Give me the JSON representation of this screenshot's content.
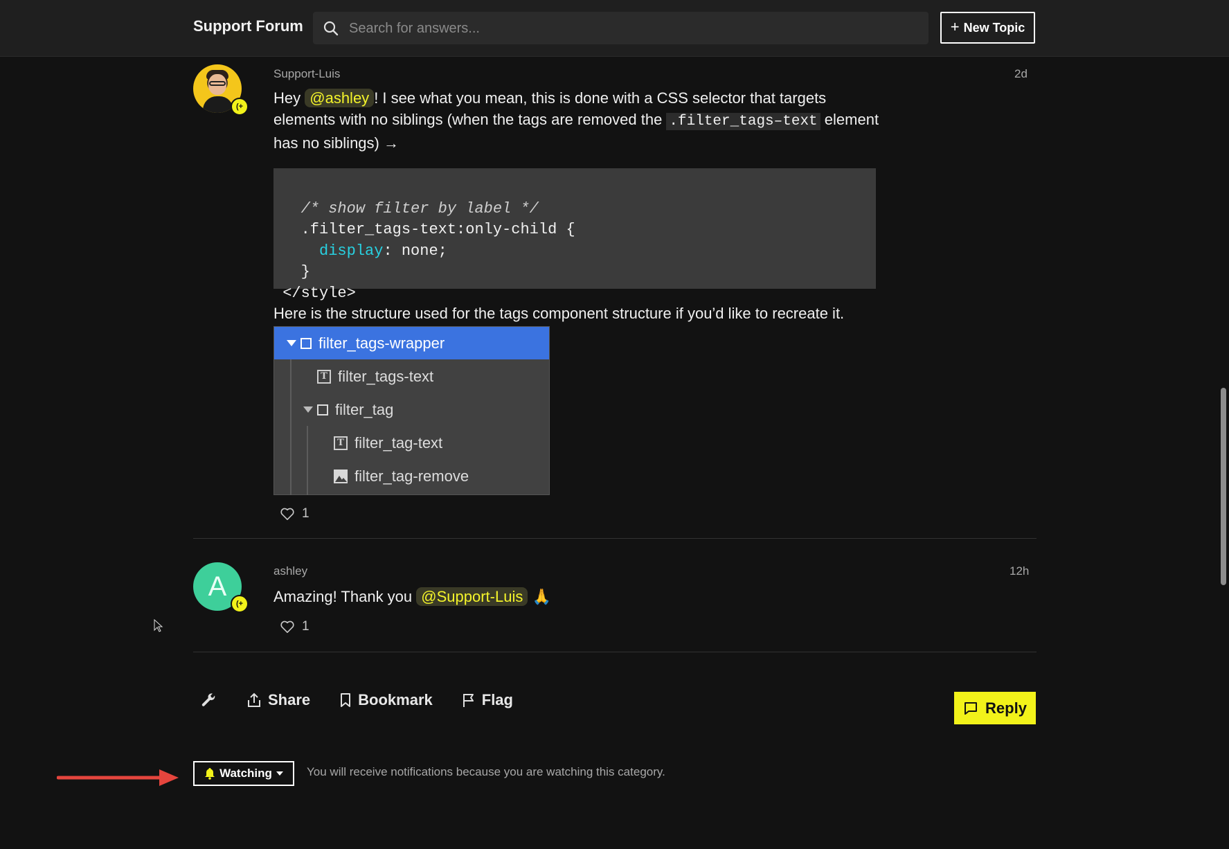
{
  "header": {
    "brand": "Support Forum",
    "search_placeholder": "Search for answers...",
    "new_topic_label": "New Topic"
  },
  "posts": [
    {
      "username": "Support-Luis",
      "time": "2d",
      "text_before_mention": "Hey ",
      "mention": "@ashley",
      "text_after_mention": "! I see what you mean, this is done with a CSS selector that targets elements with no siblings (when the tags are removed the ",
      "inline_code": ".filter_tags–text",
      "text_after_code": " element has no siblings) →",
      "code_lines": [
        {
          "indent": "   ",
          "text": "/* show filter by label */",
          "kind": "comment"
        },
        {
          "indent": "   ",
          "text": ".filter_tags-text:only-child {",
          "kind": "plain"
        },
        {
          "indent": "     ",
          "prop": "display",
          "rest": ": none;",
          "kind": "decl"
        },
        {
          "indent": "   ",
          "text": "}",
          "kind": "plain"
        },
        {
          "indent": " ",
          "text": "</style>",
          "kind": "plain"
        }
      ],
      "structure_text": "Here is the structure used for the tags component structure if you’d like to recreate it.",
      "tree": [
        {
          "label": "filter_tags-wrapper",
          "icon": "box-icon",
          "caret": true,
          "selected": true
        },
        {
          "label": "filter_tags-text",
          "icon": "text-icon",
          "caret": false,
          "selected": false
        },
        {
          "label": "filter_tag",
          "icon": "box-icon",
          "caret": true,
          "selected": false
        },
        {
          "label": "filter_tag-text",
          "icon": "text-icon",
          "caret": false,
          "selected": false
        },
        {
          "label": "filter_tag-remove",
          "icon": "image-icon",
          "caret": false,
          "selected": false
        }
      ],
      "likes": "1"
    },
    {
      "username": "ashley",
      "avatar_letter": "A",
      "time": "12h",
      "text_before_mention": "Amazing! Thank you ",
      "mention": "@Support-Luis",
      "emoji": "🙏",
      "likes": "1"
    }
  ],
  "actions": {
    "share": "Share",
    "bookmark": "Bookmark",
    "flag": "Flag",
    "reply": "Reply"
  },
  "notifications": {
    "button_label": "Watching",
    "note": "You will receive notifications because you are watching this category."
  },
  "colors": {
    "accent": "#f2f21a",
    "selected_row": "#3b73e0",
    "avatar_green": "#3ecf9a",
    "annotation_arrow": "#e5453d"
  }
}
